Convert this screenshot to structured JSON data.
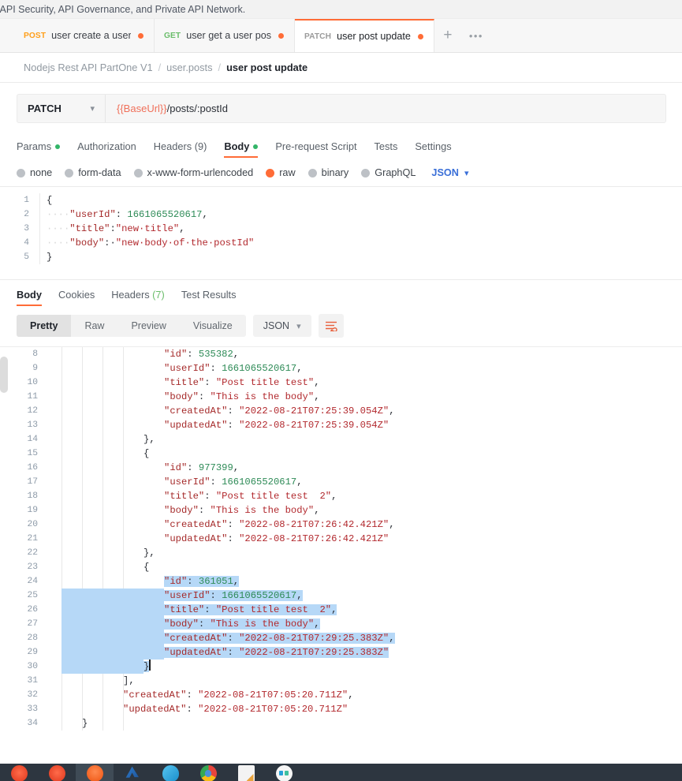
{
  "promo": {
    "text": "ration, API Security, API Governance, and Private API Network."
  },
  "tabs": [
    {
      "method": "POST",
      "method_class": "post",
      "label": "user create a user po",
      "dirty": true,
      "active": false
    },
    {
      "method": "GET",
      "method_class": "get",
      "label": "user get a user posts",
      "dirty": true,
      "active": false
    },
    {
      "method": "PATCH",
      "method_class": "patch",
      "label": "user post update",
      "dirty": true,
      "active": true
    }
  ],
  "tab_actions": {
    "add_label": "+",
    "more_label": "•••"
  },
  "breadcrumb": {
    "collection": "Nodejs Rest API PartOne V1",
    "folder": "user.posts",
    "request": "user post update",
    "separator": "/"
  },
  "url_bar": {
    "method": "PATCH",
    "url_variable": "{{BaseUrl}}",
    "url_path": "/posts/:postId"
  },
  "request_tabs": [
    {
      "label": "Params",
      "dot": true,
      "active": false
    },
    {
      "label": "Authorization",
      "dot": false,
      "active": false
    },
    {
      "label": "Headers (9)",
      "dot": false,
      "active": false
    },
    {
      "label": "Body",
      "dot": true,
      "active": true
    },
    {
      "label": "Pre-request Script",
      "dot": false,
      "active": false
    },
    {
      "label": "Tests",
      "dot": false,
      "active": false
    },
    {
      "label": "Settings",
      "dot": false,
      "active": false
    }
  ],
  "body_types": [
    {
      "label": "none",
      "selected": false
    },
    {
      "label": "form-data",
      "selected": false
    },
    {
      "label": "x-www-form-urlencoded",
      "selected": false
    },
    {
      "label": "raw",
      "selected": true
    },
    {
      "label": "binary",
      "selected": false
    },
    {
      "label": "GraphQL",
      "selected": false
    }
  ],
  "body_format": {
    "label": "JSON"
  },
  "request_body": {
    "lines": [
      {
        "n": "1",
        "segments": [
          {
            "t": "{",
            "c": "pn"
          }
        ]
      },
      {
        "n": "2",
        "segments": [
          {
            "t": "····",
            "c": "dot"
          },
          {
            "t": "\"userId\"",
            "c": "k"
          },
          {
            "t": ": ",
            "c": "pn"
          },
          {
            "t": "1661065520617",
            "c": "num"
          },
          {
            "t": ",",
            "c": "pn"
          }
        ]
      },
      {
        "n": "3",
        "segments": [
          {
            "t": "····",
            "c": "dot"
          },
          {
            "t": "\"title\"",
            "c": "k"
          },
          {
            "t": ":",
            "c": "pn"
          },
          {
            "t": "\"new·title\"",
            "c": "str"
          },
          {
            "t": ",",
            "c": "pn"
          }
        ]
      },
      {
        "n": "4",
        "segments": [
          {
            "t": "····",
            "c": "dot"
          },
          {
            "t": "\"body\"",
            "c": "k"
          },
          {
            "t": ":·",
            "c": "pn"
          },
          {
            "t": "\"new·body·of·the·postId\"",
            "c": "str"
          }
        ]
      },
      {
        "n": "5",
        "segments": [
          {
            "t": "}",
            "c": "pn"
          }
        ]
      }
    ]
  },
  "response_tabs": [
    {
      "label": "Body",
      "active": true
    },
    {
      "label": "Cookies",
      "active": false
    },
    {
      "label": "Headers (7)",
      "active": false
    },
    {
      "label": "Test Results",
      "active": false
    }
  ],
  "response_toolbar": {
    "views": [
      {
        "label": "Pretty",
        "active": true
      },
      {
        "label": "Raw",
        "active": false
      },
      {
        "label": "Preview",
        "active": false
      },
      {
        "label": "Visualize",
        "active": false
      }
    ],
    "format": "JSON",
    "wrap_icon": "word-wrap-icon"
  },
  "response_body": {
    "lines": [
      {
        "n": "8",
        "indent": 5,
        "hl": false,
        "segments": [
          {
            "t": "\"id\"",
            "c": "k"
          },
          {
            "t": ": ",
            "c": "pn"
          },
          {
            "t": "535382",
            "c": "num"
          },
          {
            "t": ",",
            "c": "pn"
          }
        ]
      },
      {
        "n": "9",
        "indent": 5,
        "hl": false,
        "segments": [
          {
            "t": "\"userId\"",
            "c": "k"
          },
          {
            "t": ": ",
            "c": "pn"
          },
          {
            "t": "1661065520617",
            "c": "num"
          },
          {
            "t": ",",
            "c": "pn"
          }
        ]
      },
      {
        "n": "10",
        "indent": 5,
        "hl": false,
        "segments": [
          {
            "t": "\"title\"",
            "c": "k"
          },
          {
            "t": ": ",
            "c": "pn"
          },
          {
            "t": "\"Post title test\"",
            "c": "str"
          },
          {
            "t": ",",
            "c": "pn"
          }
        ]
      },
      {
        "n": "11",
        "indent": 5,
        "hl": false,
        "segments": [
          {
            "t": "\"body\"",
            "c": "k"
          },
          {
            "t": ": ",
            "c": "pn"
          },
          {
            "t": "\"This is the body\"",
            "c": "str"
          },
          {
            "t": ",",
            "c": "pn"
          }
        ]
      },
      {
        "n": "12",
        "indent": 5,
        "hl": false,
        "segments": [
          {
            "t": "\"createdAt\"",
            "c": "k"
          },
          {
            "t": ": ",
            "c": "pn"
          },
          {
            "t": "\"2022-08-21T07:25:39.054Z\"",
            "c": "str"
          },
          {
            "t": ",",
            "c": "pn"
          }
        ]
      },
      {
        "n": "13",
        "indent": 5,
        "hl": false,
        "segments": [
          {
            "t": "\"updatedAt\"",
            "c": "k"
          },
          {
            "t": ": ",
            "c": "pn"
          },
          {
            "t": "\"2022-08-21T07:25:39.054Z\"",
            "c": "str"
          }
        ]
      },
      {
        "n": "14",
        "indent": 4,
        "hl": false,
        "segments": [
          {
            "t": "},",
            "c": "pn"
          }
        ]
      },
      {
        "n": "15",
        "indent": 4,
        "hl": false,
        "segments": [
          {
            "t": "{",
            "c": "pn"
          }
        ]
      },
      {
        "n": "16",
        "indent": 5,
        "hl": false,
        "segments": [
          {
            "t": "\"id\"",
            "c": "k"
          },
          {
            "t": ": ",
            "c": "pn"
          },
          {
            "t": "977399",
            "c": "num"
          },
          {
            "t": ",",
            "c": "pn"
          }
        ]
      },
      {
        "n": "17",
        "indent": 5,
        "hl": false,
        "segments": [
          {
            "t": "\"userId\"",
            "c": "k"
          },
          {
            "t": ": ",
            "c": "pn"
          },
          {
            "t": "1661065520617",
            "c": "num"
          },
          {
            "t": ",",
            "c": "pn"
          }
        ]
      },
      {
        "n": "18",
        "indent": 5,
        "hl": false,
        "segments": [
          {
            "t": "\"title\"",
            "c": "k"
          },
          {
            "t": ": ",
            "c": "pn"
          },
          {
            "t": "\"Post title test  2\"",
            "c": "str"
          },
          {
            "t": ",",
            "c": "pn"
          }
        ]
      },
      {
        "n": "19",
        "indent": 5,
        "hl": false,
        "segments": [
          {
            "t": "\"body\"",
            "c": "k"
          },
          {
            "t": ": ",
            "c": "pn"
          },
          {
            "t": "\"This is the body\"",
            "c": "str"
          },
          {
            "t": ",",
            "c": "pn"
          }
        ]
      },
      {
        "n": "20",
        "indent": 5,
        "hl": false,
        "segments": [
          {
            "t": "\"createdAt\"",
            "c": "k"
          },
          {
            "t": ": ",
            "c": "pn"
          },
          {
            "t": "\"2022-08-21T07:26:42.421Z\"",
            "c": "str"
          },
          {
            "t": ",",
            "c": "pn"
          }
        ]
      },
      {
        "n": "21",
        "indent": 5,
        "hl": false,
        "segments": [
          {
            "t": "\"updatedAt\"",
            "c": "k"
          },
          {
            "t": ": ",
            "c": "pn"
          },
          {
            "t": "\"2022-08-21T07:26:42.421Z\"",
            "c": "str"
          }
        ]
      },
      {
        "n": "22",
        "indent": 4,
        "hl": false,
        "segments": [
          {
            "t": "},",
            "c": "pn"
          }
        ]
      },
      {
        "n": "23",
        "indent": 4,
        "hl": false,
        "segments": [
          {
            "t": "{",
            "c": "pn"
          }
        ]
      },
      {
        "n": "24",
        "indent": 5,
        "hl": true,
        "hl_text_only": true,
        "segments": [
          {
            "t": "\"id\"",
            "c": "k"
          },
          {
            "t": ": ",
            "c": "pn"
          },
          {
            "t": "361051",
            "c": "num"
          },
          {
            "t": ",",
            "c": "pn"
          }
        ]
      },
      {
        "n": "25",
        "indent": 5,
        "hl": true,
        "segments": [
          {
            "t": "\"userId\"",
            "c": "k"
          },
          {
            "t": ": ",
            "c": "pn"
          },
          {
            "t": "1661065520617",
            "c": "num"
          },
          {
            "t": ",",
            "c": "pn"
          }
        ]
      },
      {
        "n": "26",
        "indent": 5,
        "hl": true,
        "segments": [
          {
            "t": "\"title\"",
            "c": "k"
          },
          {
            "t": ": ",
            "c": "pn"
          },
          {
            "t": "\"Post title test  2\"",
            "c": "str"
          },
          {
            "t": ",",
            "c": "pn"
          }
        ]
      },
      {
        "n": "27",
        "indent": 5,
        "hl": true,
        "segments": [
          {
            "t": "\"body\"",
            "c": "k"
          },
          {
            "t": ": ",
            "c": "pn"
          },
          {
            "t": "\"This is the body\"",
            "c": "str"
          },
          {
            "t": ",",
            "c": "pn"
          }
        ]
      },
      {
        "n": "28",
        "indent": 5,
        "hl": true,
        "segments": [
          {
            "t": "\"createdAt\"",
            "c": "k"
          },
          {
            "t": ": ",
            "c": "pn"
          },
          {
            "t": "\"2022-08-21T07:29:25.383Z\"",
            "c": "str"
          },
          {
            "t": ",",
            "c": "pn"
          }
        ]
      },
      {
        "n": "29",
        "indent": 5,
        "hl": true,
        "segments": [
          {
            "t": "\"updatedAt\"",
            "c": "k"
          },
          {
            "t": ": ",
            "c": "pn"
          },
          {
            "t": "\"2022-08-21T07:29:25.383Z\"",
            "c": "str"
          }
        ]
      },
      {
        "n": "30",
        "indent": 4,
        "hl": true,
        "caret": true,
        "segments": [
          {
            "t": "}",
            "c": "pn"
          }
        ]
      },
      {
        "n": "31",
        "indent": 3,
        "hl": false,
        "segments": [
          {
            "t": "],",
            "c": "pn"
          }
        ]
      },
      {
        "n": "32",
        "indent": 3,
        "hl": false,
        "segments": [
          {
            "t": "\"createdAt\"",
            "c": "k"
          },
          {
            "t": ": ",
            "c": "pn"
          },
          {
            "t": "\"2022-08-21T07:05:20.711Z\"",
            "c": "str"
          },
          {
            "t": ",",
            "c": "pn"
          }
        ]
      },
      {
        "n": "33",
        "indent": 3,
        "hl": false,
        "segments": [
          {
            "t": "\"updatedAt\"",
            "c": "k"
          },
          {
            "t": ": ",
            "c": "pn"
          },
          {
            "t": "\"2022-08-21T07:05:20.711Z\"",
            "c": "str"
          }
        ]
      },
      {
        "n": "34",
        "indent": 1,
        "hl": false,
        "segments": [
          {
            "t": "}",
            "c": "pn"
          }
        ]
      }
    ]
  },
  "taskbar": {
    "items": [
      {
        "name": "app-icon-1",
        "icon": "ic-red",
        "active": false
      },
      {
        "name": "app-icon-2",
        "icon": "ic-red",
        "active": false
      },
      {
        "name": "app-icon-3",
        "icon": "ic-orange",
        "active": true
      },
      {
        "name": "app-icon-4",
        "icon": "ic-blue",
        "active": false
      },
      {
        "name": "app-icon-5",
        "icon": "ic-cloud",
        "active": false
      },
      {
        "name": "app-icon-6",
        "icon": "ic-chrome",
        "active": false
      },
      {
        "name": "app-icon-7",
        "icon": "ic-doc",
        "active": false
      },
      {
        "name": "app-icon-8",
        "icon": "ic-ghost",
        "active": false
      }
    ]
  },
  "colors": {
    "accent": "#ff6c37",
    "green": "#33b568",
    "selection": "#b6d8f7",
    "json_blue": "#3a6fd8"
  }
}
